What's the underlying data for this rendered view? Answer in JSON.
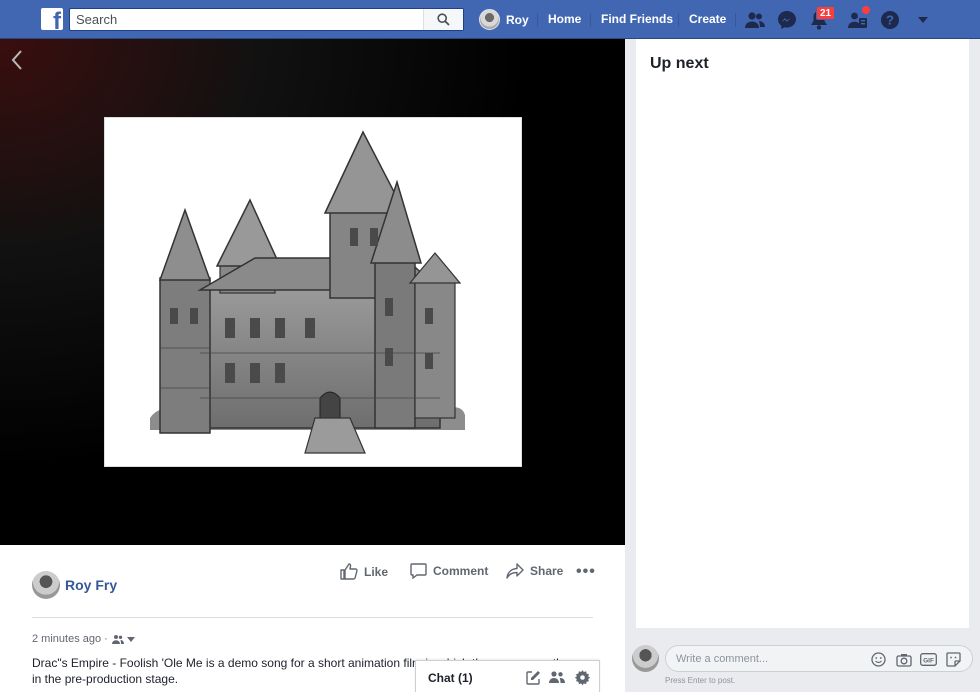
{
  "nav": {
    "logo_letter": "f",
    "search_placeholder": "Search",
    "profile_name": "Roy",
    "home_label": "Home",
    "find_friends_label": "Find Friends",
    "create_label": "Create",
    "notification_count": "21",
    "icons": [
      "friend-requests-icon",
      "messenger-icon",
      "notifications-icon",
      "quick-help-icon",
      "help-icon",
      "account-menu-caret-icon"
    ]
  },
  "post": {
    "author": "Roy Fry",
    "like_label": "Like",
    "comment_label": "Comment",
    "share_label": "Share",
    "more_label": "•••",
    "timestamp": "2 minutes ago ·",
    "description": "Drac\"s Empire - Foolish 'Ole Me is a demo song for a short animation film in which they are currently in the pre-production stage."
  },
  "sidebar": {
    "up_next_title": "Up next",
    "comment_placeholder": "Write a comment...",
    "press_enter_hint": "Press Enter to post."
  },
  "chat": {
    "label": "Chat (1)"
  },
  "colors": {
    "brand": "#4267b2",
    "link": "#365899",
    "badge": "#fa3e3e"
  }
}
